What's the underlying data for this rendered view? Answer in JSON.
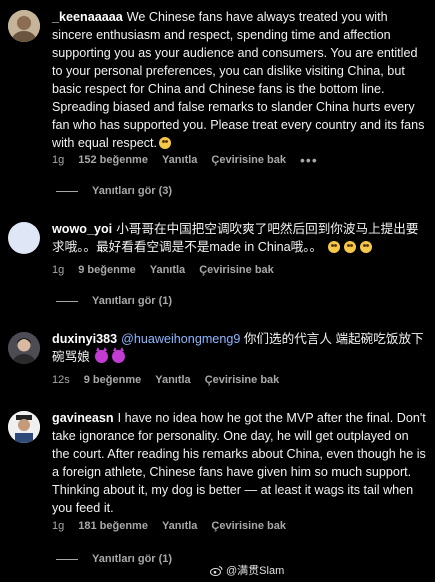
{
  "comments": [
    {
      "username": "_keenaaaaa",
      "text": "We Chinese fans have always treated you with sincere enthusiasm and respect, spending time and affection supporting you as your audience and consumers. You are entitled to your personal preferences, you can dislike visiting China, but basic respect for China and Chinese fans is the bottom line. Spreading biased and false remarks to slander China hurts every fan who has supported you. Please treat every country and its fans with equal respect.",
      "time": "1g",
      "likes": "152 beğenme",
      "reply": "Yanıtla",
      "translate": "Çevirisine bak",
      "more": "•••",
      "view_replies": "Yanıtları gör (3)"
    },
    {
      "username": "wowo_yoi",
      "text": "小哥哥在中国把空调吹爽了吧然后回到你波马上提出要求哦。。最好看看空调是不是made in China哦。。",
      "time": "1g",
      "likes": "9 beğenme",
      "reply": "Yanıtla",
      "translate": "Çevirisine bak",
      "view_replies": "Yanıtları gör (1)"
    },
    {
      "username": "duxinyi383",
      "mention": "@huaweihongmeng9",
      "text": "你们选的代言人 端起碗吃饭放下碗骂娘",
      "time": "12s",
      "likes": "9 beğenme",
      "reply": "Yanıtla",
      "translate": "Çevirisine bak"
    },
    {
      "username": "gavineasn",
      "text": "I have no idea how he got the MVP after the final. Don't take ignorance for personality. One day, he will get outplayed on the court. After reading his remarks about China, even though he is a foreign athlete, Chinese fans have given him so much support. Thinking about it, my dog is better — at least it wags its tail when you feed it.",
      "time": "1g",
      "likes": "181 beğenme",
      "reply": "Yanıtla",
      "translate": "Çevirisine bak",
      "view_replies": "Yanıtları gör (1)"
    }
  ],
  "watermark": "@满贯Slam",
  "colors": {
    "background": "#000000",
    "text": "#f2f2f2",
    "secondary": "#a8a8a8",
    "mention": "#8fb5ff"
  }
}
